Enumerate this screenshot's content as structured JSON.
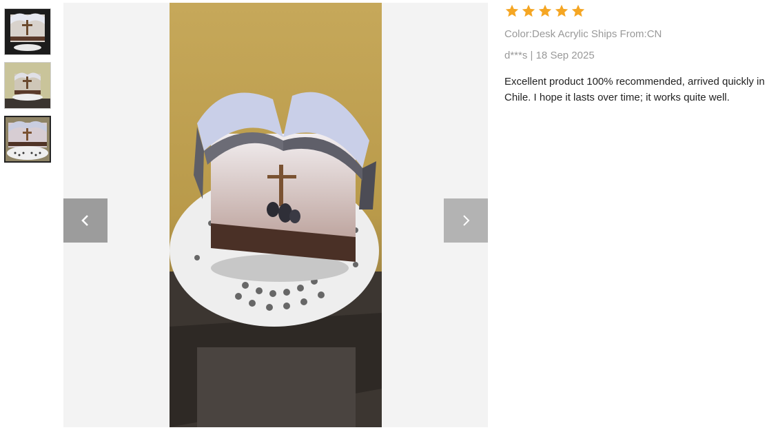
{
  "thumbnails": [
    {
      "id": "thumb-1",
      "active": false
    },
    {
      "id": "thumb-2",
      "active": false
    },
    {
      "id": "thumb-3",
      "active": true
    }
  ],
  "viewer": {
    "prev_icon": "chevron-left-icon",
    "next_icon": "chevron-right-icon"
  },
  "review": {
    "rating": 5,
    "star_color": "#f5a623",
    "attributes": "Color:Desk Acrylic Ships From:CN",
    "author_date": "d***s | 18 Sep 2025",
    "text": "Excellent product 100% recommended, arrived quickly in Chile. I hope it lasts over time; it works quite well."
  }
}
